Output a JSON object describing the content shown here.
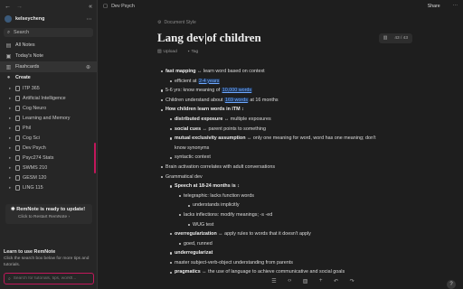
{
  "sidebar": {
    "user": "kelseycheng",
    "search_label": "Search",
    "nav": [
      {
        "label": "All Notes",
        "icon": "notes-icon"
      },
      {
        "label": "Today's Note",
        "icon": "calendar-icon"
      },
      {
        "label": "Flashcards",
        "icon": "flashcards-icon"
      }
    ],
    "create_label": "Create",
    "docs": [
      {
        "label": "ITP 365"
      },
      {
        "label": "Artificial Intelligence"
      },
      {
        "label": "Cog Neuro"
      },
      {
        "label": "Learning and Memory"
      },
      {
        "label": "Phil"
      },
      {
        "label": "Cog Sci"
      },
      {
        "label": "Dev Psych"
      },
      {
        "label": "Psyc274 Stats"
      },
      {
        "label": "SWMS 210"
      },
      {
        "label": "GESM 120"
      },
      {
        "label": "LING 115"
      }
    ],
    "update_title": "RemNote is ready to update!",
    "update_sub": "Click to Restart RemNote",
    "learn_title": "Learn to use RemNote",
    "learn_text": "Click the search box below for more tips and tutorials.",
    "learn_placeholder": "Search for tutorials, tips, workfl..."
  },
  "topbar": {
    "breadcrumb": "Dev Psych",
    "share": "Share"
  },
  "doc": {
    "doc_style": "Document Style",
    "title_a": "Lang dev",
    "title_b": "of children",
    "upload": "Upload",
    "tag": "Tag",
    "card_count": "43 / 43",
    "lines": [
      {
        "indent": 0,
        "parts": [
          {
            "t": "fast mapping",
            "b": true
          },
          {
            "t": " ↔ learn word based on context"
          }
        ]
      },
      {
        "indent": 1,
        "parts": [
          {
            "t": "efficient at "
          },
          {
            "t": "2-4 years",
            "hl": true
          }
        ]
      },
      {
        "indent": 0,
        "parts": [
          {
            "t": "5-6 yrs: know meaning of "
          },
          {
            "t": "10,000 words",
            "hl": true
          }
        ]
      },
      {
        "indent": 0,
        "parts": [
          {
            "t": "Children understand about "
          },
          {
            "t": "169 words",
            "hl": true
          },
          {
            "t": " at 16 months"
          }
        ]
      },
      {
        "indent": 0,
        "parts": [
          {
            "t": "How children learn words in ITM ",
            "b": true
          },
          {
            "t": "↕"
          }
        ]
      },
      {
        "indent": 1,
        "parts": [
          {
            "t": "distributed exposure",
            "b": true
          },
          {
            "t": " ↔ multiple exposures"
          }
        ]
      },
      {
        "indent": 1,
        "parts": [
          {
            "t": "social cues",
            "b": true
          },
          {
            "t": " ↔ parent points to something"
          }
        ]
      },
      {
        "indent": 1,
        "parts": [
          {
            "t": "mutual exclusivity assumption",
            "b": true
          },
          {
            "t": " ↔ only one meaning for word, word has one meaning; don't"
          }
        ]
      },
      {
        "indent": 1,
        "cont": true,
        "parts": [
          {
            "t": "know synonyms"
          }
        ]
      },
      {
        "indent": 1,
        "parts": [
          {
            "t": "syntactic context"
          }
        ]
      },
      {
        "indent": 0,
        "parts": [
          {
            "t": "Brain activation correlates with adult conversations"
          }
        ]
      },
      {
        "indent": 0,
        "parts": [
          {
            "t": "Grammatical dev"
          }
        ]
      },
      {
        "indent": 1,
        "parts": [
          {
            "t": "Speech at 18-24 months is ",
            "b": true
          },
          {
            "t": "↕"
          }
        ]
      },
      {
        "indent": 2,
        "parts": [
          {
            "t": "telegraphic: lacks function words"
          }
        ]
      },
      {
        "indent": 3,
        "parts": [
          {
            "t": "understands implicitly"
          }
        ]
      },
      {
        "indent": 2,
        "parts": [
          {
            "t": "lacks inflections: modify meanings; -s -ed"
          }
        ]
      },
      {
        "indent": 3,
        "parts": [
          {
            "t": "WUG test"
          }
        ]
      },
      {
        "indent": 1,
        "parts": [
          {
            "t": "overregularization",
            "b": true
          },
          {
            "t": " ↔ apply rules to words that it doesn't apply"
          }
        ]
      },
      {
        "indent": 2,
        "parts": [
          {
            "t": "goed, runned"
          }
        ]
      },
      {
        "indent": 1,
        "parts": [
          {
            "t": "underregularizat",
            "b": true
          }
        ]
      },
      {
        "indent": 1,
        "parts": [
          {
            "t": "master subject-verb-object understanding from parents"
          }
        ]
      },
      {
        "indent": 1,
        "parts": [
          {
            "t": "pragmatics",
            "b": true
          },
          {
            "t": " ↔ the use of language to achieve communicative and social goals"
          }
        ]
      }
    ]
  },
  "colors": {
    "accent": "#c2185b",
    "highlight": "#6ea8ff"
  }
}
